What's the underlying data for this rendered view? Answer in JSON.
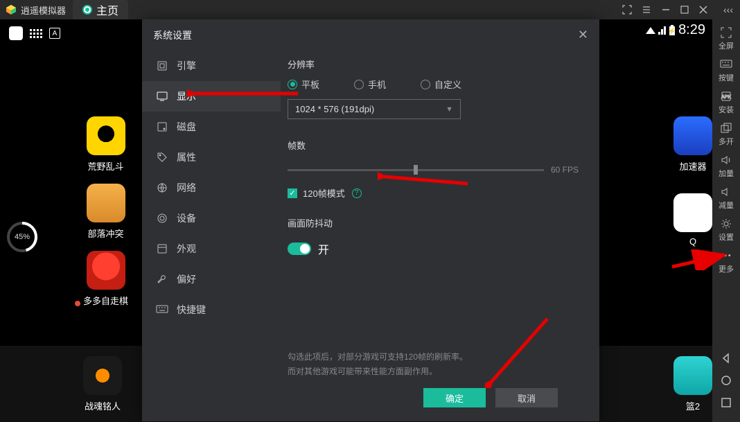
{
  "app": {
    "name": "逍遥模拟器",
    "home_tab": "主页"
  },
  "statusbar": {
    "time": "8:29"
  },
  "ring": {
    "percent": "45%"
  },
  "rsb": {
    "fullscreen": "全屏",
    "keymap": "按键",
    "install": "安装",
    "multi": "多开",
    "volup": "加量",
    "voldown": "减量",
    "settings": "设置",
    "more": "更多"
  },
  "apps_left": [
    {
      "name": "荒野乱斗"
    },
    {
      "name": "部落冲突"
    },
    {
      "name": "多多自走棋",
      "dot": true
    }
  ],
  "apps_right": [
    {
      "name": "加速器"
    },
    {
      "name": "Q"
    }
  ],
  "dock_left": {
    "name": "战魂铭人"
  },
  "dock_right": {
    "name": "篮2"
  },
  "modal": {
    "title": "系统设置",
    "nav": {
      "engine": "引擎",
      "display": "显示",
      "disk": "磁盘",
      "attr": "属性",
      "network": "网络",
      "device": "设备",
      "appearance": "外观",
      "pref": "偏好",
      "shortcut": "快捷键"
    },
    "resolution": {
      "title": "分辨率",
      "tablet": "平板",
      "phone": "手机",
      "custom": "自定义",
      "value": "1024 * 576 (191dpi)"
    },
    "fps": {
      "title": "帧数",
      "value": "60 FPS",
      "mode120": "120帧模式"
    },
    "anti_shake": {
      "title": "画面防抖动",
      "on": "开"
    },
    "hint1": "勾选此项后，对部分游戏可支持120帧的刷新率。",
    "hint2": "而对其他游戏可能带来性能方面副作用。",
    "ok": "确定",
    "cancel": "取消"
  }
}
